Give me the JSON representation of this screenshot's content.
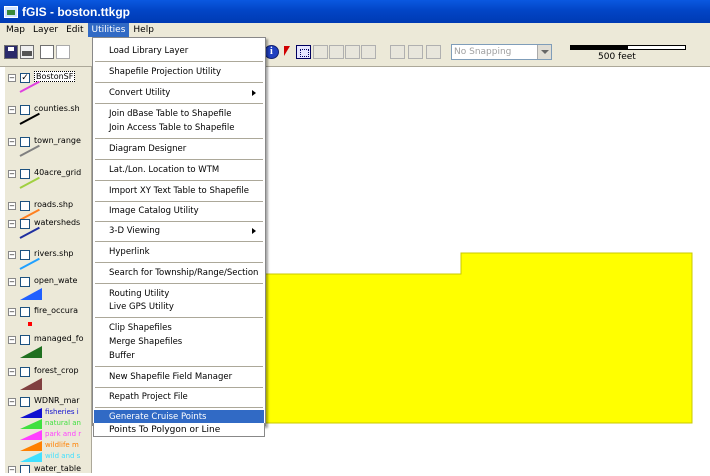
{
  "window": {
    "title": "fGIS - boston.ttkgp"
  },
  "menubar": {
    "items": [
      "Map",
      "Layer",
      "Edit",
      "Utilities",
      "Help"
    ],
    "active": "Utilities"
  },
  "toolbar": {
    "snapping_value": "No Snapping",
    "scale_label": "500 feet"
  },
  "layers": [
    {
      "name": "BostonSF",
      "checked": true,
      "symbol_color": "#e040e0"
    },
    {
      "name": "counties.sh",
      "checked": false,
      "symbol_color": "#000000"
    },
    {
      "name": "town_range",
      "checked": false,
      "symbol_color": "#808080"
    },
    {
      "name": "40acre_grid",
      "checked": false,
      "symbol_color": "#a0d040"
    },
    {
      "name": "roads.shp",
      "checked": false,
      "symbol_color": "#ff8020"
    },
    {
      "name": "watersheds",
      "checked": false,
      "symbol_color": "#2030a0"
    },
    {
      "name": "rivers.shp",
      "checked": false,
      "symbol_color": "#20a0ff"
    },
    {
      "name": "open_wate",
      "checked": false,
      "symbol_color": "#2060ff"
    },
    {
      "name": "fire_occura",
      "checked": false,
      "symbol_color": "#ff0000"
    },
    {
      "name": "managed_fo",
      "checked": false,
      "symbol_color": "#207020"
    },
    {
      "name": "forest_crop",
      "checked": false,
      "symbol_color": "#804040"
    },
    {
      "name": "WDNR_mar",
      "checked": false,
      "symbol_color": "#000000"
    },
    {
      "name": "water_table",
      "checked": false,
      "symbol_color": "#000000"
    }
  ],
  "wdnr_sublegend": [
    {
      "label": "fisheries i",
      "color": "#1010d0"
    },
    {
      "label": "natural an",
      "color": "#40e040"
    },
    {
      "label": "park and r",
      "color": "#ff40ff"
    },
    {
      "label": "wildlife m",
      "color": "#ff8000"
    },
    {
      "label": "wild and s",
      "color": "#40e0ff"
    }
  ],
  "utilities_menu": [
    {
      "label": "Load Library Layer",
      "submenu": false,
      "highlighted": false
    },
    {
      "label": "Shapefile Projection Utility",
      "submenu": false,
      "highlighted": false
    },
    {
      "label": "Convert Utility",
      "submenu": true,
      "highlighted": false
    },
    {
      "label": "Join dBase Table to Shapefile",
      "submenu": false,
      "highlighted": false
    },
    {
      "label": "Join Access Table to Shapefile",
      "submenu": false,
      "highlighted": false
    },
    {
      "label": "Diagram Designer",
      "submenu": false,
      "highlighted": false
    },
    {
      "label": "Lat./Lon. Location to WTM",
      "submenu": false,
      "highlighted": false
    },
    {
      "label": "Import XY Text Table to Shapefile",
      "submenu": false,
      "highlighted": false
    },
    {
      "label": "Image Catalog Utility",
      "submenu": false,
      "highlighted": false
    },
    {
      "label": "3-D Viewing",
      "submenu": true,
      "highlighted": false
    },
    {
      "label": "Hyperlink",
      "submenu": false,
      "highlighted": false
    },
    {
      "label": "Search for Township/Range/Section",
      "submenu": false,
      "highlighted": false
    },
    {
      "label": "Routing Utility",
      "submenu": false,
      "highlighted": false
    },
    {
      "label": "Live GPS Utility",
      "submenu": false,
      "highlighted": false
    },
    {
      "label": "Clip Shapefiles",
      "submenu": false,
      "highlighted": false
    },
    {
      "label": "Merge Shapefiles",
      "submenu": false,
      "highlighted": false
    },
    {
      "label": "Buffer",
      "submenu": false,
      "highlighted": false
    },
    {
      "label": "New Shapefile Field Manager",
      "submenu": false,
      "highlighted": false
    },
    {
      "label": "Repath Project File",
      "submenu": false,
      "highlighted": false
    },
    {
      "label": "Generate Cruise Points",
      "submenu": false,
      "highlighted": true
    },
    {
      "label": "Points To Polygon or Line",
      "submenu": false,
      "highlighted": false
    }
  ],
  "map": {
    "polygon_fill": "#ffff00",
    "polygon_stroke": "#c8c800",
    "line_color": "#e040e0"
  }
}
